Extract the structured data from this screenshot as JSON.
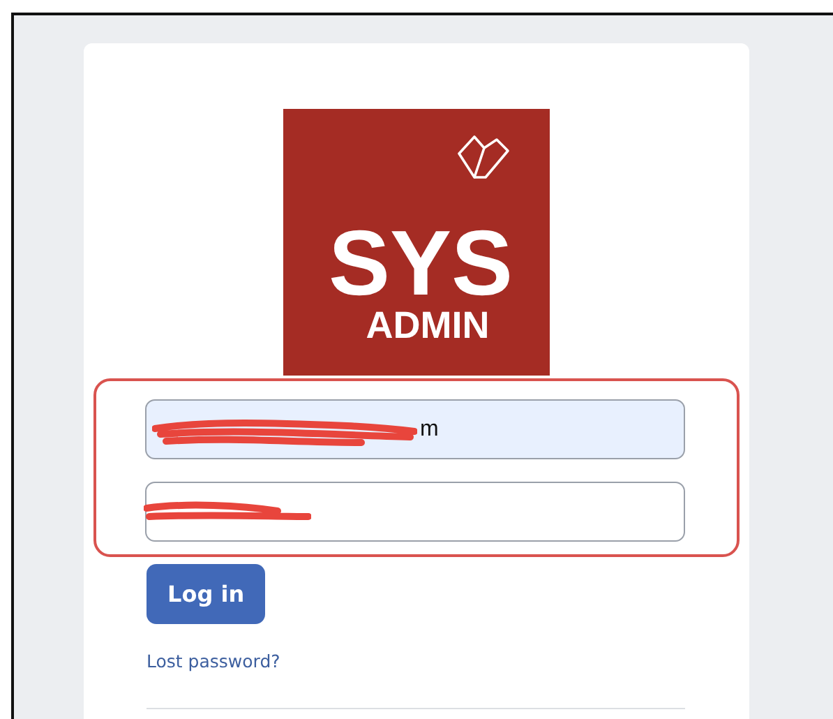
{
  "logo": {
    "title": "SYS",
    "subtitle": "ADMIN"
  },
  "login_form": {
    "email": {
      "value": "m",
      "redacted": true
    },
    "password": {
      "redacted": true
    },
    "submit_button": "Log in",
    "lost_password_link": "Lost password?"
  }
}
